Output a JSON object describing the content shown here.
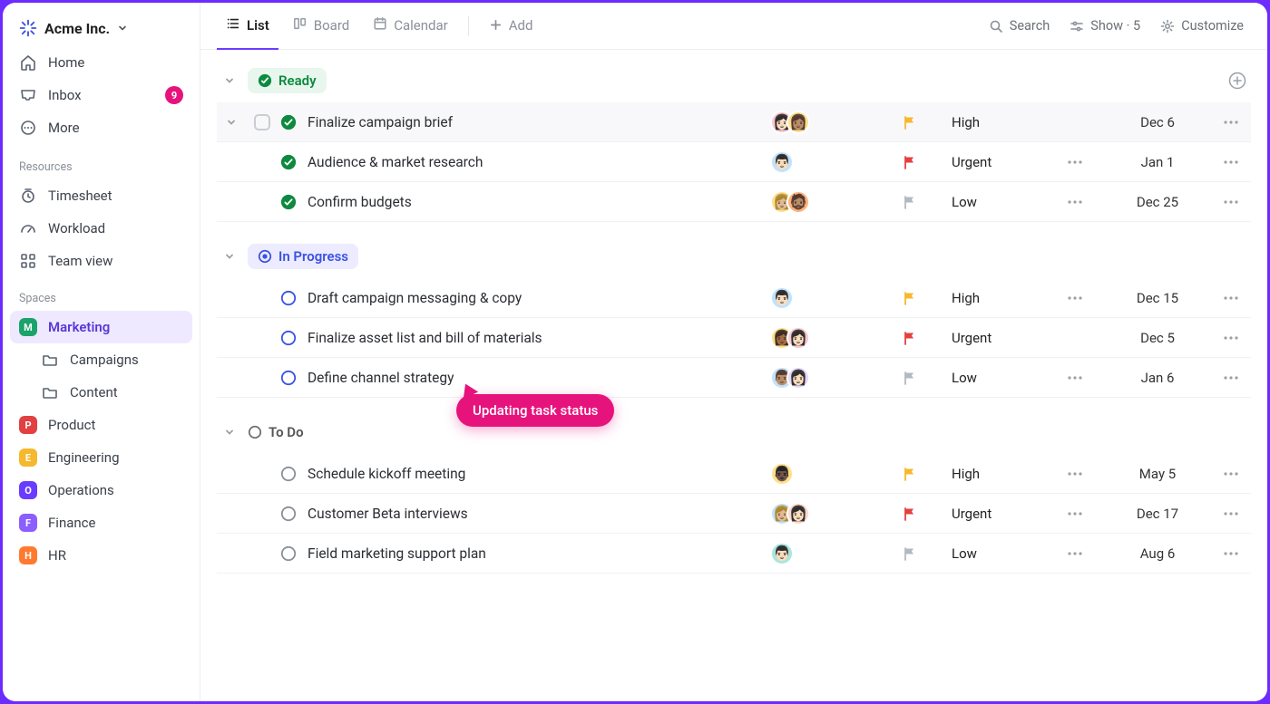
{
  "workspace": {
    "name": "Acme Inc."
  },
  "sidebar": {
    "nav": [
      {
        "label": "Home",
        "icon": "home"
      },
      {
        "label": "Inbox",
        "icon": "inbox",
        "badge": "9"
      },
      {
        "label": "More",
        "icon": "more"
      }
    ],
    "sections": [
      {
        "heading": "Resources",
        "items": [
          {
            "label": "Timesheet",
            "icon": "timer"
          },
          {
            "label": "Workload",
            "icon": "gauge"
          },
          {
            "label": "Team view",
            "icon": "grid"
          }
        ]
      },
      {
        "heading": "Spaces",
        "items": [
          {
            "label": "Marketing",
            "chip": "M",
            "color": "#1aa36b",
            "active": true,
            "children": [
              {
                "label": "Campaigns",
                "icon": "folder"
              },
              {
                "label": "Content",
                "icon": "folder"
              }
            ]
          },
          {
            "label": "Product",
            "chip": "P",
            "color": "#e34141"
          },
          {
            "label": "Engineering",
            "chip": "E",
            "color": "#f5b82e"
          },
          {
            "label": "Operations",
            "chip": "O",
            "color": "#6a3cff"
          },
          {
            "label": "Finance",
            "chip": "F",
            "color": "#8a5eff"
          },
          {
            "label": "HR",
            "chip": "H",
            "color": "#ff7a2f"
          }
        ]
      }
    ]
  },
  "toolbar": {
    "tabs": [
      {
        "label": "List",
        "icon": "list",
        "active": true
      },
      {
        "label": "Board",
        "icon": "board"
      },
      {
        "label": "Calendar",
        "icon": "calendar"
      }
    ],
    "add_label": "Add",
    "right": {
      "search": "Search",
      "show": "Show · 5",
      "customize": "Customize"
    }
  },
  "groups": [
    {
      "key": "ready",
      "label": "Ready",
      "status_style": "ready",
      "show_add": true,
      "tasks": [
        {
          "title": "Finalize campaign brief",
          "status": "done",
          "hovered": true,
          "checkbox": true,
          "assignees": [
            {
              "bg": "#f9c7d2",
              "e": "👩🏻"
            },
            {
              "bg": "#ffe08a",
              "e": "👩🏽"
            }
          ],
          "priority": "High",
          "flag": "high",
          "date": "Dec 6"
        },
        {
          "title": "Audience & market research",
          "status": "done",
          "assignees": [
            {
              "bg": "#bfe3ff",
              "e": "👨🏻"
            }
          ],
          "priority": "Urgent",
          "flag": "urgent",
          "subtasks": true,
          "date": "Jan 1"
        },
        {
          "title": "Confirm budgets",
          "status": "done",
          "assignees": [
            {
              "bg": "#ffe08a",
              "e": "👩🏼"
            },
            {
              "bg": "#ffb27a",
              "e": "🧔🏽"
            }
          ],
          "priority": "Low",
          "flag": "low",
          "subtasks": true,
          "date": "Dec 25"
        }
      ]
    },
    {
      "key": "inprogress",
      "label": "In Progress",
      "status_style": "inprogress",
      "tasks": [
        {
          "title": "Draft campaign messaging & copy",
          "status": "progress",
          "assignees": [
            {
              "bg": "#bfe3ff",
              "e": "👨🏻"
            }
          ],
          "priority": "High",
          "flag": "high",
          "subtasks": true,
          "date": "Dec 15"
        },
        {
          "title": "Finalize asset list and bill of materials",
          "status": "progress",
          "assignees": [
            {
              "bg": "#ffe08a",
              "e": "👩🏾"
            },
            {
              "bg": "#f9c7d2",
              "e": "👩🏻"
            }
          ],
          "priority": "Urgent",
          "flag": "urgent",
          "date": "Dec 5"
        },
        {
          "title": "Define channel strategy",
          "status": "progress",
          "assignees": [
            {
              "bg": "#bfe3ff",
              "e": "👨🏽"
            },
            {
              "bg": "#e3d7ff",
              "e": "👩🏻"
            }
          ],
          "priority": "Low",
          "flag": "low",
          "subtasks": true,
          "date": "Jan 6"
        }
      ]
    },
    {
      "key": "todo",
      "label": "To Do",
      "status_style": "todo",
      "tasks": [
        {
          "title": "Schedule kickoff meeting",
          "status": "todo",
          "assignees": [
            {
              "bg": "#ffe08a",
              "e": "👨🏿"
            }
          ],
          "priority": "High",
          "flag": "high",
          "subtasks": true,
          "date": "May 5"
        },
        {
          "title": "Customer Beta interviews",
          "status": "todo",
          "assignees": [
            {
              "bg": "#bfe3ff",
              "e": "👩🏼"
            },
            {
              "bg": "#ffd7c9",
              "e": "👩🏻"
            }
          ],
          "priority": "Urgent",
          "flag": "urgent",
          "subtasks": true,
          "date": "Dec 17"
        },
        {
          "title": "Field marketing support plan",
          "status": "todo",
          "assignees": [
            {
              "bg": "#a8e6e0",
              "e": "👨🏻"
            }
          ],
          "priority": "Low",
          "flag": "low",
          "subtasks": true,
          "date": "Aug 6"
        }
      ]
    }
  ],
  "tooltip": {
    "label": "Updating task status"
  },
  "colors": {
    "flag_high": "#f5b82e",
    "flag_urgent": "#e34141",
    "flag_low": "#b3b8c2",
    "done": "#0d8a3f",
    "progress": "#3a52e2",
    "todo": "#8a8f98"
  }
}
